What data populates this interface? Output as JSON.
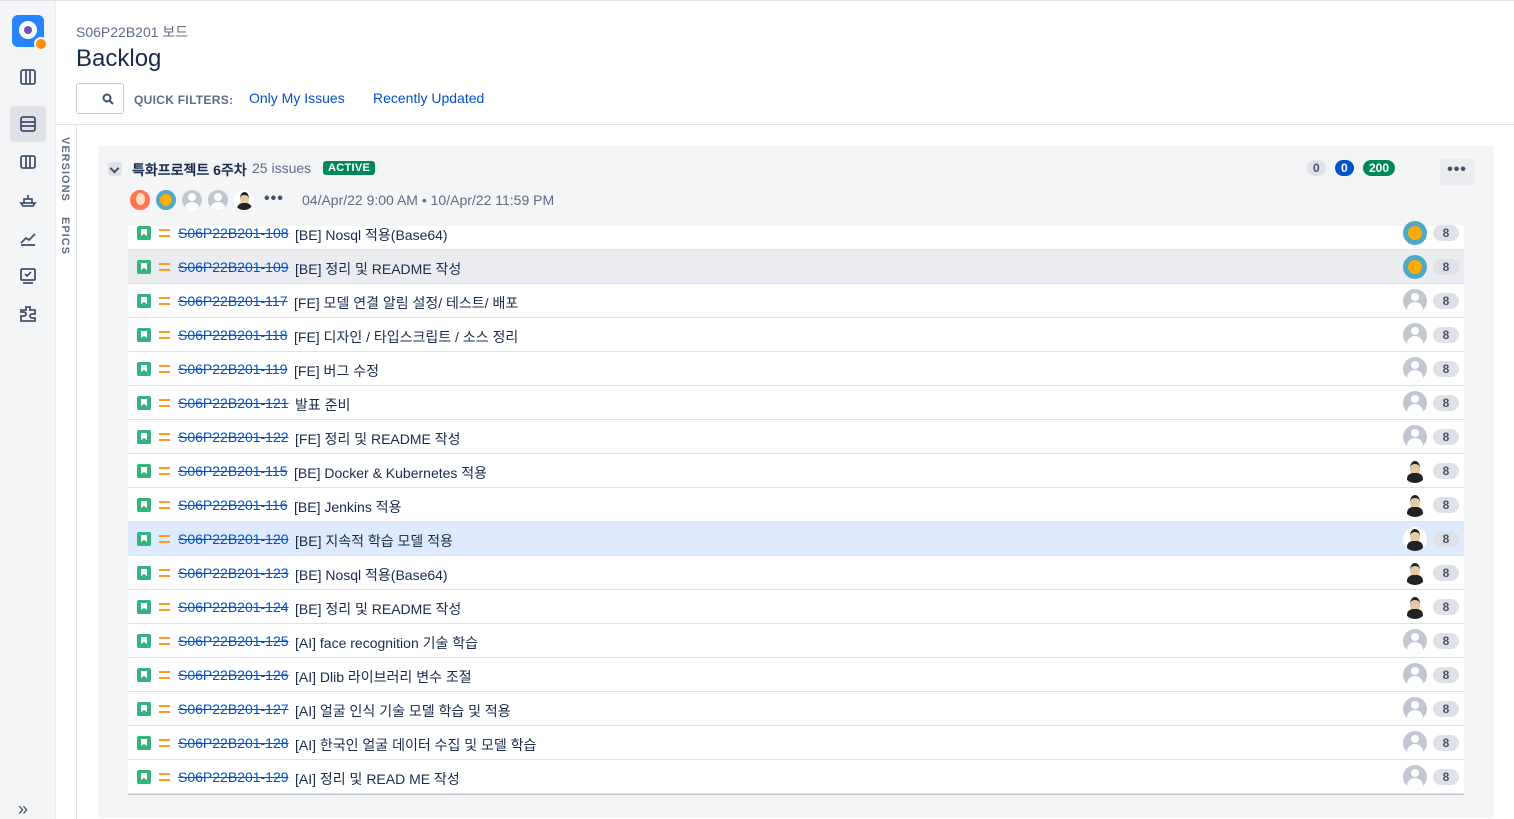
{
  "header": {
    "breadcrumb": "S06P22B201 보드",
    "title": "Backlog",
    "quick_filters_label": "QUICK FILTERS:",
    "quick_filters": [
      "Only My Issues",
      "Recently Updated"
    ]
  },
  "side_tabs": [
    "VERSIONS",
    "EPICS"
  ],
  "nav": {
    "items": [
      "board-icon",
      "backlog-icon",
      "columns-icon",
      "ship-icon",
      "reports-icon",
      "checklist-icon",
      "addon-icon"
    ],
    "expand": "»"
  },
  "sprint": {
    "name": "특화프로젝트 6주차",
    "issue_count": "25 issues",
    "status": "ACTIVE",
    "dates": "04/Apr/22 9:00 AM  •  10/Apr/22 11:59 PM",
    "counts": {
      "todo": "0",
      "in_progress": "0",
      "done": "200"
    },
    "more": "•••",
    "avatars_more": "•••"
  },
  "issues": [
    {
      "key": "S06P22B201-108",
      "summary": "[BE] Nosql 적용(Base64)",
      "assignee": "teal",
      "estimate": "8"
    },
    {
      "key": "S06P22B201-109",
      "summary": "[BE] 정리 및 README 작성",
      "assignee": "teal",
      "estimate": "8"
    },
    {
      "key": "S06P22B201-117",
      "summary": "[FE] 모델 연결 알림 설정/ 테스트/ 배포",
      "assignee": "gray",
      "estimate": "8"
    },
    {
      "key": "S06P22B201-118",
      "summary": "[FE] 디자인 / 타입스크립트 / 소스 정리",
      "assignee": "gray",
      "estimate": "8"
    },
    {
      "key": "S06P22B201-119",
      "summary": "[FE] 버그 수정",
      "assignee": "gray",
      "estimate": "8"
    },
    {
      "key": "S06P22B201-121",
      "summary": "발표 준비",
      "assignee": "gray",
      "estimate": "8"
    },
    {
      "key": "S06P22B201-122",
      "summary": "[FE] 정리 및 README 작성",
      "assignee": "gray",
      "estimate": "8"
    },
    {
      "key": "S06P22B201-115",
      "summary": "[BE] Docker & Kubernetes 적용",
      "assignee": "photo",
      "estimate": "8"
    },
    {
      "key": "S06P22B201-116",
      "summary": "[BE] Jenkins 적용",
      "assignee": "photo",
      "estimate": "8"
    },
    {
      "key": "S06P22B201-120",
      "summary": "[BE] 지속적 학습 모델 적용",
      "assignee": "photo",
      "estimate": "8"
    },
    {
      "key": "S06P22B201-123",
      "summary": "[BE] Nosql 적용(Base64)",
      "assignee": "photo",
      "estimate": "8"
    },
    {
      "key": "S06P22B201-124",
      "summary": "[BE] 정리 및 README 작성",
      "assignee": "photo",
      "estimate": "8"
    },
    {
      "key": "S06P22B201-125",
      "summary": "[AI] face recognition 기술 학습",
      "assignee": "gray",
      "estimate": "8"
    },
    {
      "key": "S06P22B201-126",
      "summary": "[AI] Dlib 라이브러리 변수 조절",
      "assignee": "gray",
      "estimate": "8"
    },
    {
      "key": "S06P22B201-127",
      "summary": "[AI] 얼굴 인식 기술 모델 학습 및 적용",
      "assignee": "gray",
      "estimate": "8"
    },
    {
      "key": "S06P22B201-128",
      "summary": "[AI] 한국인 얼굴 데이터 수집 및 모델 학습",
      "assignee": "gray",
      "estimate": "8"
    },
    {
      "key": "S06P22B201-129",
      "summary": "[AI] 정리 및 READ ME 작성",
      "assignee": "gray",
      "estimate": "8"
    }
  ],
  "colors": {
    "accent": "#0052cc",
    "active": "#00875a",
    "story": "#36b37e",
    "priority": "#ff991f"
  }
}
